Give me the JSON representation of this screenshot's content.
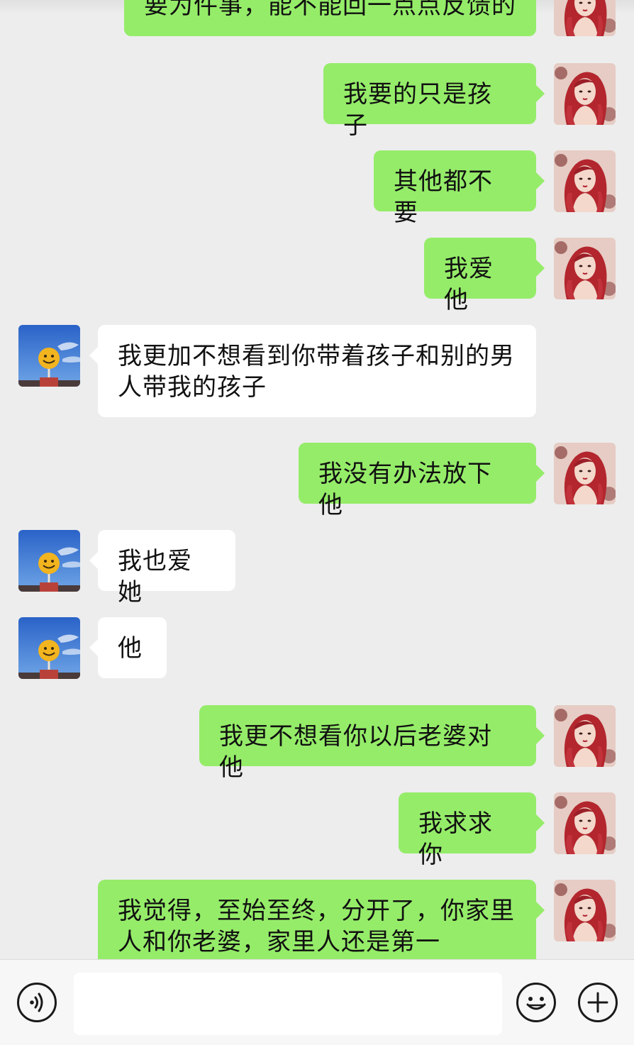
{
  "messages": [
    {
      "side": "out",
      "text": "要为件事，能不能回一点点反馈的"
    },
    {
      "side": "out",
      "text": "我要的只是孩子"
    },
    {
      "side": "out",
      "text": "其他都不要"
    },
    {
      "side": "out",
      "text": "我爱他"
    },
    {
      "side": "in",
      "text": "我更加不想看到你带着孩子和别的男人带我的孩子"
    },
    {
      "side": "out",
      "text": "我没有办法放下他"
    },
    {
      "side": "in",
      "text": "我也爱她"
    },
    {
      "side": "in",
      "text": "他"
    },
    {
      "side": "out",
      "text": "我更不想看你以后老婆对他"
    },
    {
      "side": "out",
      "text": "我求求你"
    },
    {
      "side": "out",
      "text": "我觉得，至始至终，分开了，你家里人和你老婆，家里人还是第一"
    }
  ],
  "input": {
    "value": ""
  },
  "colors": {
    "outgoing_bubble": "#95ec69",
    "incoming_bubble": "#ffffff",
    "background": "#ededed"
  },
  "icons": {
    "voice": "voice-icon",
    "emoji": "emoji-icon",
    "more": "plus-icon"
  }
}
